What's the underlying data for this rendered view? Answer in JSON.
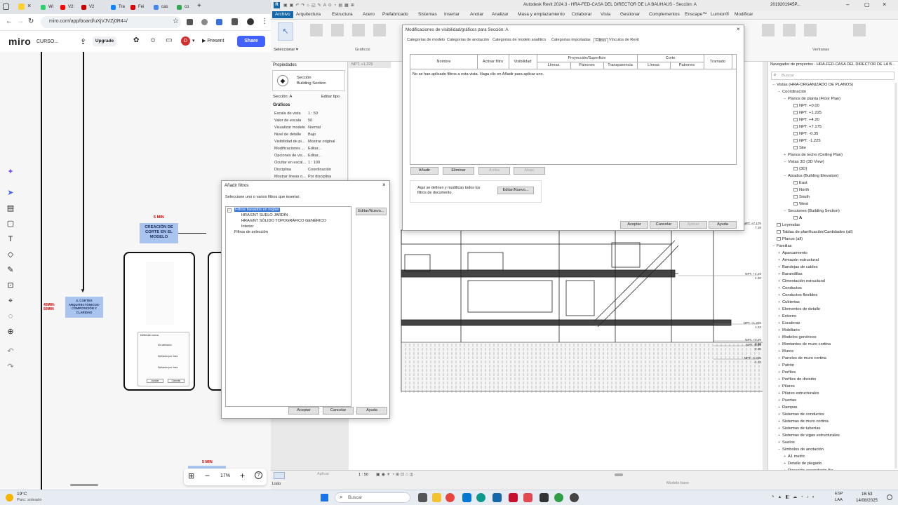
{
  "browser": {
    "tabs": [
      "Wi",
      "V2:",
      "V2",
      "Tra",
      "Fei",
      "cas",
      "co"
    ],
    "url": "miro.com/app/board/uXjVJVZj0R4=/",
    "new_tab": "+"
  },
  "miro": {
    "logo": "miro",
    "board_name": "CURSO...",
    "upgrade": "Upgrade",
    "avatar": "D",
    "present": "Present",
    "share": "Share",
    "zoom": "17%",
    "cards": {
      "timer1": "5 MIN",
      "creation": "CREACIÓN DE CORTE EN EL MODELO",
      "cortes": "4. CORTES ARQUITECTÓNICOS- COMPOSICIÓN Y CLARIDAD",
      "timer2": "45MIN- 50MIN",
      "timer3": "5 MIN"
    },
    "thumb": {
      "title": "Definición nueva",
      "opt1": "Sin definición",
      "opt2": "Definición por línea",
      "opt3": "Definición por línea",
      "btn1": "Aceptar",
      "btn2": "Cancelar"
    }
  },
  "revit": {
    "title": "Autodesk Revit 2024.3 - HRA-FED-CASA DEL DIRECTOR DE LA BAUHAUS - Sección: A",
    "user": "2019201945P...",
    "tabs": [
      "Archivo",
      "Arquitectura",
      "Estructura",
      "Acero",
      "Prefabricado",
      "Sistemas",
      "Insertar",
      "Anotar",
      "Analizar",
      "Masa y emplazamiento",
      "Colaborar",
      "Vista",
      "Gestionar",
      "Complementos",
      "Enscape™",
      "Lumion®",
      "Modificar"
    ],
    "ribbon": {
      "select": "Seleccionar",
      "graphics": "Gráficos",
      "windows": "Ventanas"
    },
    "properties": {
      "header": "Propiedades",
      "type_line1": "Sección",
      "type_line2": "Building Section",
      "instance": "Sección: A",
      "edit_type": "Editar tipo",
      "group": "Gráficos",
      "rows": [
        {
          "k": "Escala de vista",
          "v": "1 : 50"
        },
        {
          "k": "Valor de escala",
          "v": "50"
        },
        {
          "k": "Visualizar modelo",
          "v": "Normal"
        },
        {
          "k": "Nivel de detalle",
          "v": "Bajo"
        },
        {
          "k": "Visibilidad de pi...",
          "v": "Mostrar original"
        },
        {
          "k": "Modificaciones ...",
          "v": "Editar..."
        },
        {
          "k": "Opciones de vis...",
          "v": "Editar..."
        },
        {
          "k": "Ocultar en escal...",
          "v": "1 : 100"
        },
        {
          "k": "Disciplina",
          "v": "Coordinación"
        },
        {
          "k": "Mostrar líneas o...",
          "v": "Por disciplina"
        }
      ],
      "apply": "Aplicar"
    },
    "view_tab": "NPT. +1.225",
    "levels": [
      {
        "name": "NPT. +7.175",
        "val": "7.18"
      },
      {
        "name": "NPT. +4.20",
        "val": "4.20"
      },
      {
        "name": "NPT. +1.225",
        "val": "1.23"
      },
      {
        "name": "NPT. +0.00",
        "val": "0.00"
      },
      {
        "name": "NPT. -0.35",
        "val": "-0.35"
      },
      {
        "name": "NPT. -1.225",
        "val": "-1.23"
      }
    ],
    "vg_dialog": {
      "title": "Modificaciones de visibilidad/gráficos para Sección: A",
      "tabs": [
        "Categorías de modelo",
        "Categorías de anotación",
        "Categorías de modelo analítico",
        "Categorías importadas",
        "Filtros",
        "Vínculos de Revit"
      ],
      "col_name": "Nombre",
      "col_activate": "Activar filtro",
      "col_visibility": "Visibilidad",
      "group_projection": "Proyección/Superficie",
      "group_cut": "Corte",
      "sub_lines": "Líneas",
      "sub_patterns": "Patrones",
      "sub_transparency": "Transparencia",
      "sub_lines2": "Líneas",
      "sub_patterns2": "Patrones",
      "col_halftone": "Tramado",
      "empty_msg": "No se han aplicado filtros a esta vista. Haga clic en Añadir para aplicar uno.",
      "btn_add": "Añadir",
      "btn_remove": "Eliminar",
      "btn_up": "Arriba",
      "btn_down": "Abajo",
      "info": "Aquí se definen y modifican todos los filtros de documento.",
      "btn_edit_new": "Editar/Nuevo...",
      "ok": "Aceptar",
      "cancel": "Cancelar",
      "apply": "Aplicar",
      "help": "Ayuda"
    },
    "add_dialog": {
      "title": "Añadir filtros",
      "prompt": "Seleccione uno o varios filtros que insertar.",
      "tree": {
        "rule_based": "Filtros basados en reglas",
        "items": [
          "HRA ENT SUELO JARDÍN",
          "HRA ENT SÓLIDO TOPOGRÁFICO GENÉRICO",
          "Interior"
        ],
        "selection": "Filtros de selección"
      },
      "edit_new": "Editar/Nuevo...",
      "ok": "Aceptar",
      "cancel": "Cancelar",
      "help": "Ayuda"
    },
    "project_browser": {
      "title": "Navegador de proyectos - HRA-FED-CASA DEL DIRECTOR DE LA B...",
      "search": "Buscar",
      "items": [
        {
          "lvl": 0,
          "ex": "−",
          "label": "Vistas (HRA-ORGANIZADO DE PLANOS)"
        },
        {
          "lvl": 1,
          "ex": "−",
          "label": "Coordinación"
        },
        {
          "lvl": 2,
          "ex": "−",
          "label": "Planos de planta (Floor Plan)"
        },
        {
          "lvl": 3,
          "ex": "",
          "label": "NPT. +0.00"
        },
        {
          "lvl": 3,
          "ex": "",
          "label": "NPT. +1.225"
        },
        {
          "lvl": 3,
          "ex": "",
          "label": "NPT. +4.20"
        },
        {
          "lvl": 3,
          "ex": "",
          "label": "NPT. +7.175"
        },
        {
          "lvl": 3,
          "ex": "",
          "label": "NPT. -0.35"
        },
        {
          "lvl": 3,
          "ex": "",
          "label": "NPT. -1.225"
        },
        {
          "lvl": 3,
          "ex": "",
          "label": "Site"
        },
        {
          "lvl": 2,
          "ex": "+",
          "label": "Planos de techo (Ceiling Plan)"
        },
        {
          "lvl": 2,
          "ex": "−",
          "label": "Vistas 3D (3D View)"
        },
        {
          "lvl": 3,
          "ex": "",
          "label": "{3D}"
        },
        {
          "lvl": 2,
          "ex": "−",
          "label": "Alzados (Building Elevation)"
        },
        {
          "lvl": 3,
          "ex": "",
          "label": "East"
        },
        {
          "lvl": 3,
          "ex": "",
          "label": "North"
        },
        {
          "lvl": 3,
          "ex": "",
          "label": "South"
        },
        {
          "lvl": 3,
          "ex": "",
          "label": "West"
        },
        {
          "lvl": 2,
          "ex": "−",
          "label": "Secciones (Building Section)"
        },
        {
          "lvl": 3,
          "ex": "",
          "label": "A"
        },
        {
          "lvl": 0,
          "ex": "",
          "label": "Leyendas"
        },
        {
          "lvl": 0,
          "ex": "",
          "label": "Tablas de planificación/Cantidades (all)"
        },
        {
          "lvl": 0,
          "ex": "",
          "label": "Planos (all)"
        },
        {
          "lvl": 0,
          "ex": "−",
          "label": "Familias"
        },
        {
          "lvl": 1,
          "ex": "+",
          "label": "Aparcamiento"
        },
        {
          "lvl": 1,
          "ex": "+",
          "label": "Armazón estructural"
        },
        {
          "lvl": 1,
          "ex": "+",
          "label": "Bandejas de cables"
        },
        {
          "lvl": 1,
          "ex": "+",
          "label": "Barandillas"
        },
        {
          "lvl": 1,
          "ex": "+",
          "label": "Cimentación estructural"
        },
        {
          "lvl": 1,
          "ex": "+",
          "label": "Conductos"
        },
        {
          "lvl": 1,
          "ex": "+",
          "label": "Conductos flexibles"
        },
        {
          "lvl": 1,
          "ex": "+",
          "label": "Cubiertas"
        },
        {
          "lvl": 1,
          "ex": "+",
          "label": "Elementos de detalle"
        },
        {
          "lvl": 1,
          "ex": "+",
          "label": "Entorno"
        },
        {
          "lvl": 1,
          "ex": "+",
          "label": "Escaleras"
        },
        {
          "lvl": 1,
          "ex": "+",
          "label": "Mobiliario"
        },
        {
          "lvl": 1,
          "ex": "+",
          "label": "Modelos genéricos"
        },
        {
          "lvl": 1,
          "ex": "+",
          "label": "Montantes de muro cortina"
        },
        {
          "lvl": 1,
          "ex": "+",
          "label": "Muros"
        },
        {
          "lvl": 1,
          "ex": "+",
          "label": "Paneles de muro cortina"
        },
        {
          "lvl": 1,
          "ex": "+",
          "label": "Patrón"
        },
        {
          "lvl": 1,
          "ex": "+",
          "label": "Perfiles"
        },
        {
          "lvl": 1,
          "ex": "+",
          "label": "Perfiles de división"
        },
        {
          "lvl": 1,
          "ex": "+",
          "label": "Pilares"
        },
        {
          "lvl": 1,
          "ex": "+",
          "label": "Pilares estructurales"
        },
        {
          "lvl": 1,
          "ex": "+",
          "label": "Puertas"
        },
        {
          "lvl": 1,
          "ex": "+",
          "label": "Rampas"
        },
        {
          "lvl": 1,
          "ex": "+",
          "label": "Sistemas de conductos"
        },
        {
          "lvl": 1,
          "ex": "+",
          "label": "Sistemas de muro cortina"
        },
        {
          "lvl": 1,
          "ex": "+",
          "label": "Sistemas de tuberías"
        },
        {
          "lvl": 1,
          "ex": "+",
          "label": "Sistemas de vigas estructurales"
        },
        {
          "lvl": 1,
          "ex": "+",
          "label": "Suelos"
        },
        {
          "lvl": 1,
          "ex": "−",
          "label": "Símbolos de anotación"
        },
        {
          "lvl": 2,
          "ex": "+",
          "label": "A1 metric"
        },
        {
          "lvl": 2,
          "ex": "+",
          "label": "Detalle de plegado"
        },
        {
          "lvl": 2,
          "ex": "+",
          "label": "Dirección ascendente fija"
        }
      ]
    },
    "status": {
      "left": "Listo",
      "scale": "1 : 50",
      "model": "Modelo base",
      "apply": "Aplicar"
    }
  },
  "taskbar": {
    "weather_temp": "19°C",
    "weather_desc": "Parc. soleado",
    "search": "Buscar",
    "lang1": "ESP",
    "lang2": "LAA",
    "time": "16:53",
    "date": "14/08/2025"
  }
}
